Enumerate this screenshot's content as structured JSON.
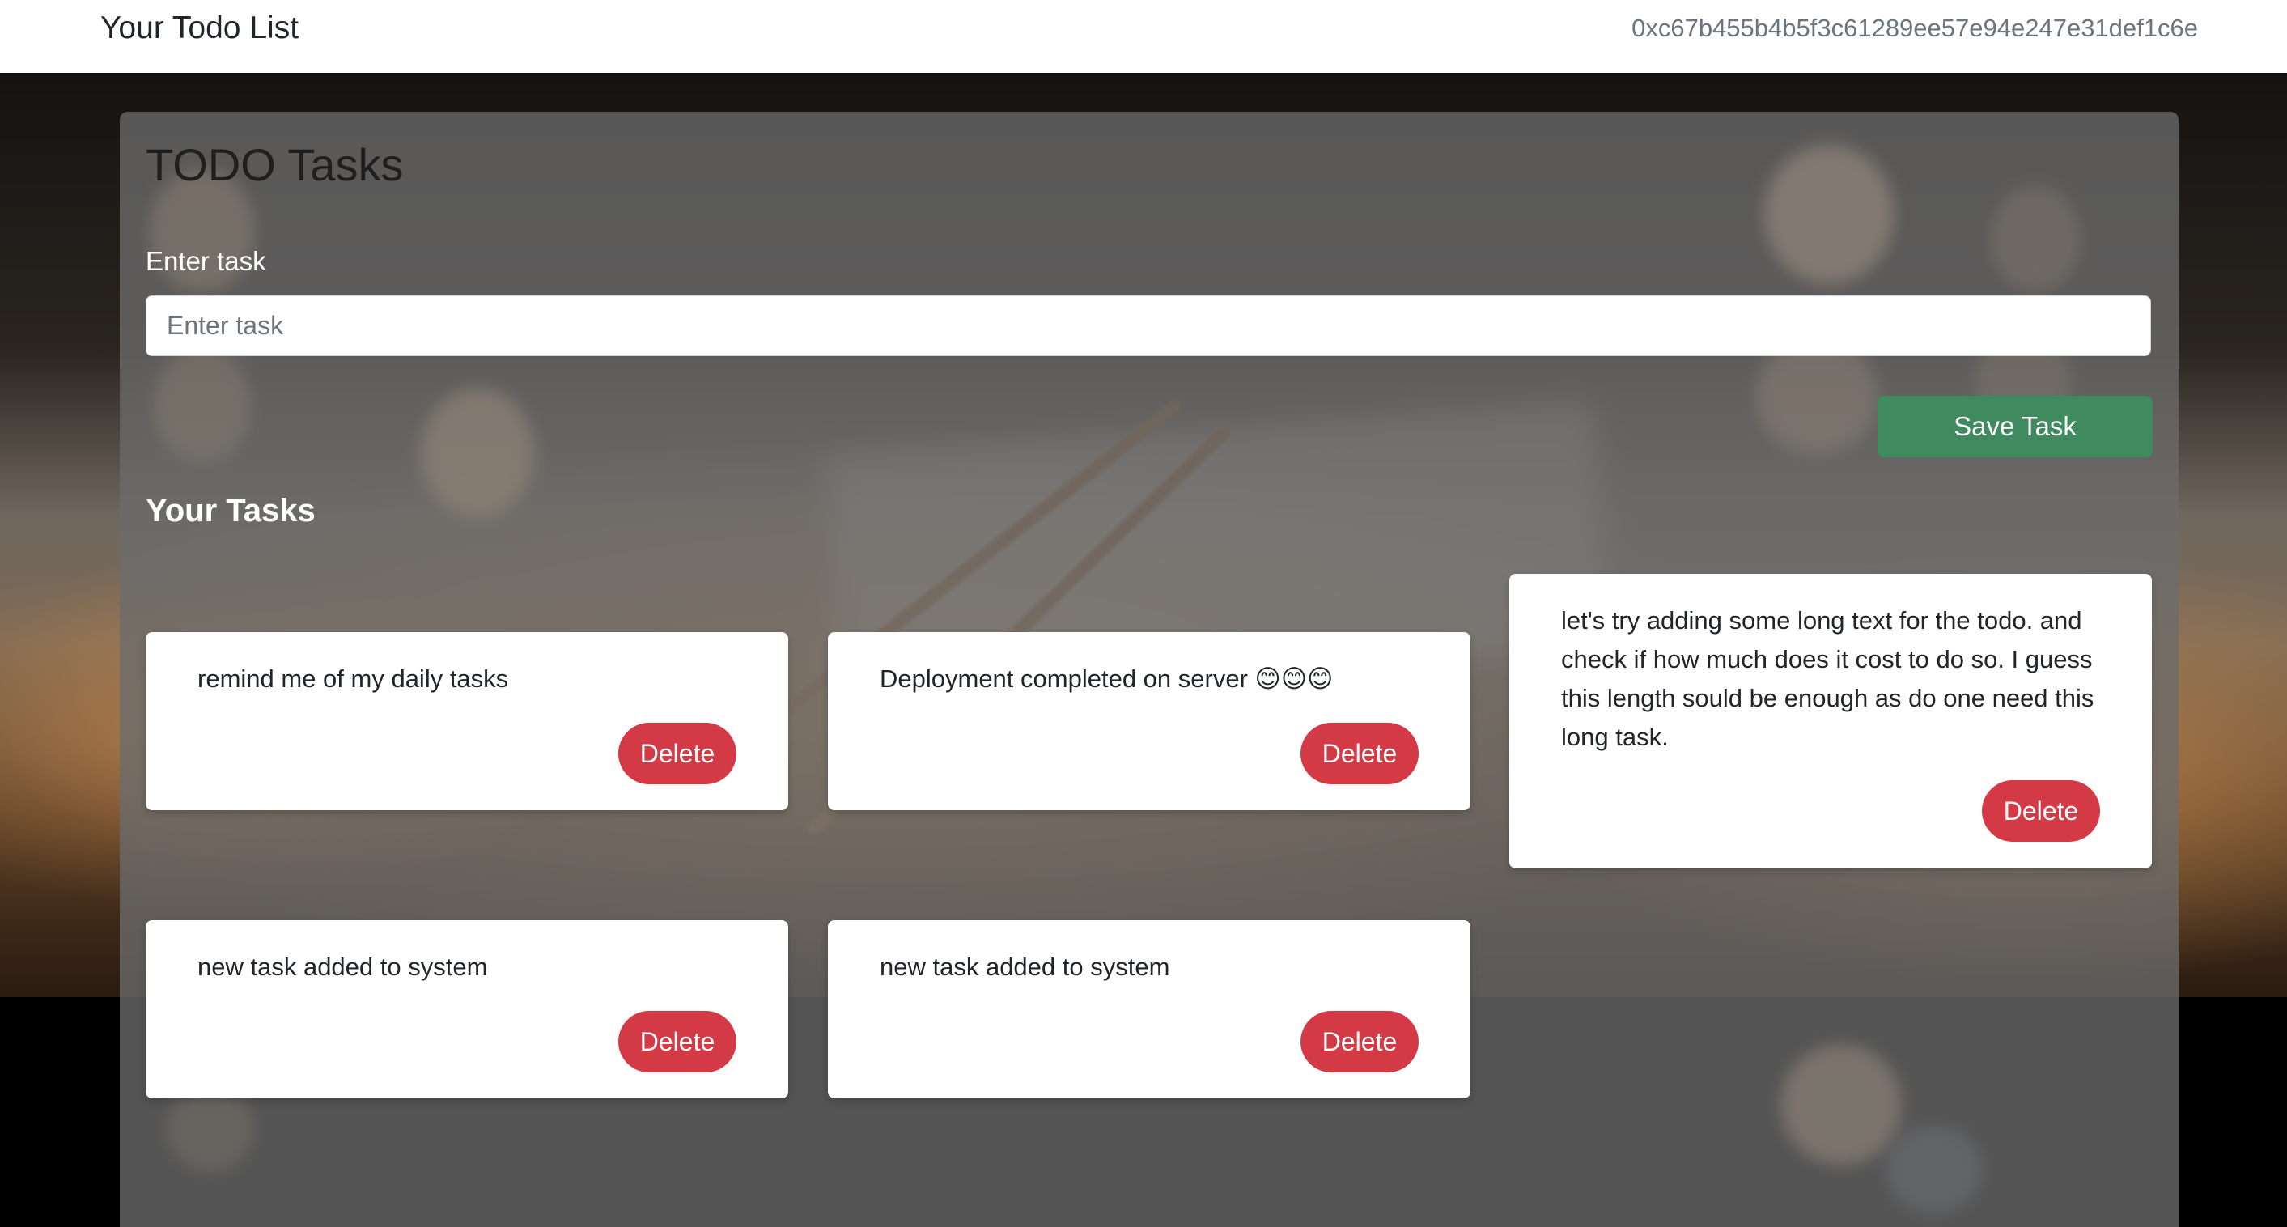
{
  "navbar": {
    "brand": "Your Todo List",
    "wallet_address": "0xc67b455b4b5f3c61289ee57e94e247e31def1c6e"
  },
  "panel": {
    "title": "TODO Tasks",
    "input_label": "Enter task",
    "input_placeholder": "Enter task",
    "input_value": "",
    "save_label": "Save Task",
    "tasks_heading": "Your Tasks"
  },
  "tasks": [
    {
      "text": "remind me of my daily tasks",
      "delete_label": "Delete"
    },
    {
      "text": "Deployment completed on server 😊😊😊",
      "delete_label": "Delete"
    },
    {
      "text": "let's try adding some long text for the todo. and check if how much does it cost to do so. I guess this length sould be enough as do one need this long task.",
      "delete_label": "Delete"
    },
    {
      "text": "new task added to system",
      "delete_label": "Delete"
    },
    {
      "text": "new task added to system",
      "delete_label": "Delete"
    }
  ],
  "colors": {
    "save_button": "#3f8a5f",
    "delete_button": "#d33a45",
    "panel_overlay": "#6c6c6c"
  }
}
